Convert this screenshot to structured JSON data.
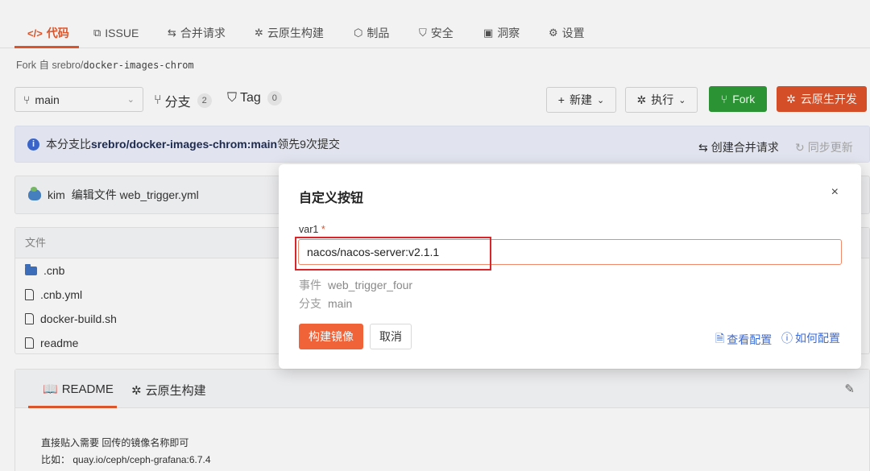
{
  "tabs": [
    {
      "icon": "</>",
      "label": "代码"
    },
    {
      "icon": "⧉",
      "label": "ISSUE"
    },
    {
      "icon": "⇆",
      "label": "合并请求"
    },
    {
      "icon": "✲",
      "label": "云原生构建"
    },
    {
      "icon": "⬡",
      "label": "制品"
    },
    {
      "icon": "⛉",
      "label": "安全"
    },
    {
      "icon": "▣",
      "label": "洞察"
    },
    {
      "icon": "⚙",
      "label": "设置"
    }
  ],
  "fork": {
    "prefix": "Fork 自",
    "owner": "srebro/",
    "repo": "docker-images-chrom"
  },
  "branch": {
    "icon": "⑂",
    "name": "main"
  },
  "branches": {
    "icon": "⑂",
    "label": "分支",
    "count": "2"
  },
  "tags": {
    "icon": "⛉",
    "label": "Tag",
    "count": "0"
  },
  "toolbar": {
    "new_label": "新建",
    "run_label": "执行",
    "fork_label": "Fork",
    "cloud_dev_label": "云原生开发"
  },
  "info": {
    "icon": "i",
    "prefix": "本分支比",
    "ref": "srebro/docker-images-chrom:main",
    "suffix": "领先9次提交",
    "create_mr": "创建合并请求",
    "sync": "同步更新"
  },
  "commit": {
    "author": "kim",
    "message": "编辑文件 web_trigger.yml"
  },
  "files": {
    "header": "文件",
    "items": [
      {
        "name": ".cnb",
        "type": "folder"
      },
      {
        "name": ".cnb.yml",
        "type": "file"
      },
      {
        "name": "docker-build.sh",
        "type": "file"
      },
      {
        "name": "readme",
        "type": "file"
      }
    ]
  },
  "readme": {
    "tab_readme": "README",
    "tab_build": "云原生构建",
    "line1": "直接贴入需要 回传的镜像名称即可",
    "line2": "比如： quay.io/ceph/ceph-grafana:6.7.4"
  },
  "modal": {
    "title": "自定义按钮",
    "close": "×",
    "field_label": "var1",
    "required_mark": "*",
    "field_value": "nacos/nacos-server:v2.1.1",
    "event_label": "事件",
    "event_value": "web_trigger_four",
    "branch_label": "分支",
    "branch_value": "main",
    "primary_label": "构建镜像",
    "cancel_label": "取消",
    "view_config": "查看配置",
    "how_config": "如何配置"
  },
  "colors": {
    "accent": "#e65a2e",
    "fork_green": "#2e9b36",
    "cloud_orange": "#e0532b",
    "link_blue": "#3d6bd6"
  }
}
